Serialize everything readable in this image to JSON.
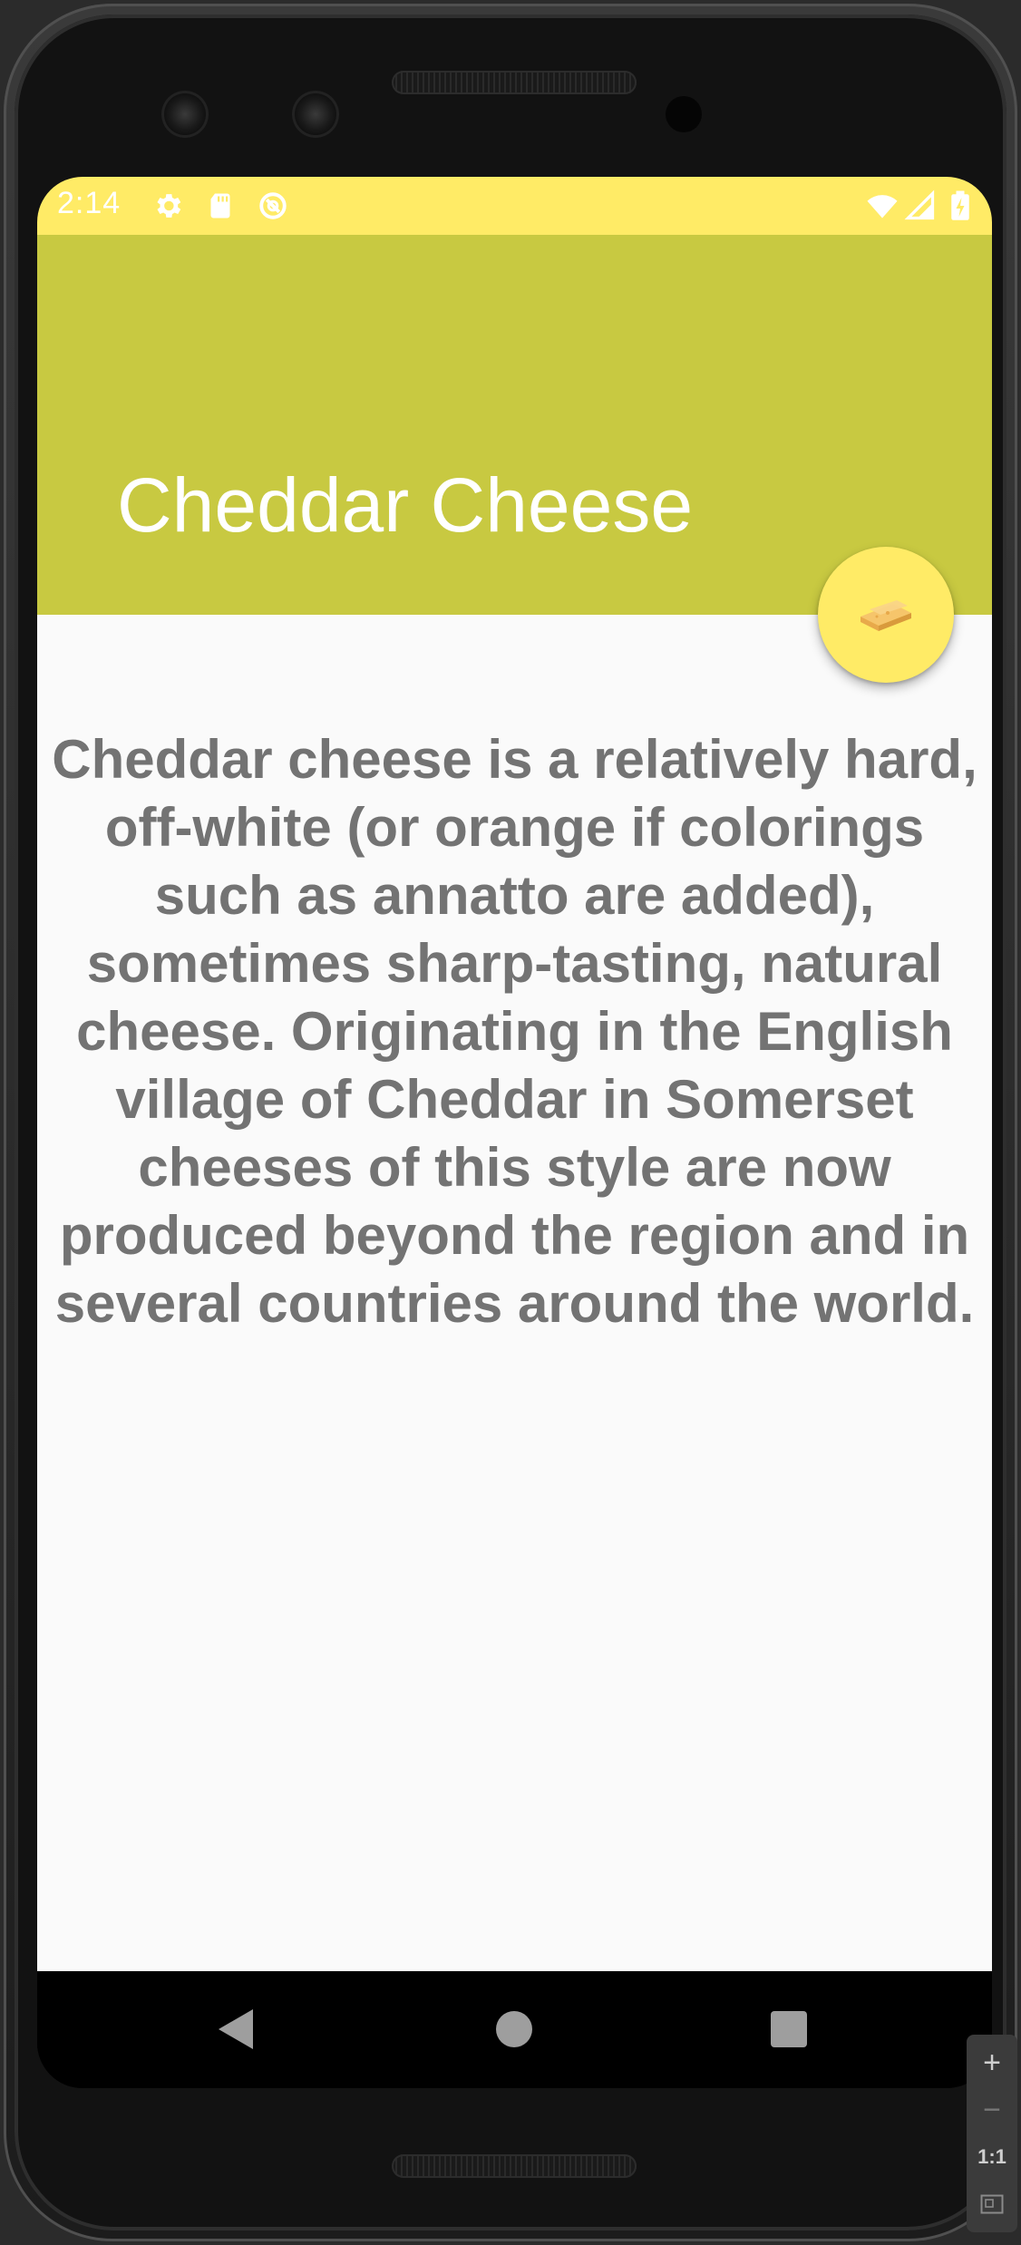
{
  "status_bar": {
    "time": "2:14",
    "background": "#ffeb66",
    "left_icons": [
      "gear-icon",
      "sd-card-icon",
      "data-saver-icon"
    ],
    "right_icons": [
      "wifi-icon",
      "signal-icon",
      "battery-icon"
    ]
  },
  "app_bar": {
    "title": "Cheddar Cheese",
    "background": "#c8c941"
  },
  "fab": {
    "icon": "cheese-icon",
    "background": "#ffeb66"
  },
  "content": {
    "description": "Cheddar cheese is a relatively hard, off-white (or orange if colorings such as annatto are added), sometimes sharp-tasting, natural cheese. Originating in the English village of Cheddar in Somerset cheeses of this style are now produced beyond the region and in several countries around the world.",
    "text_color": "#737373"
  },
  "nav_bar": {
    "buttons": [
      "back-icon",
      "home-icon",
      "recents-icon"
    ]
  },
  "emulator_controls": {
    "zoom_in": "+",
    "zoom_out": "−",
    "reset": "1:1",
    "fit": "fit-screen-icon"
  }
}
